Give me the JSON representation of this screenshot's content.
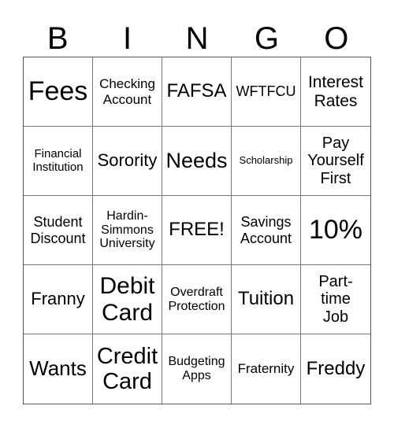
{
  "header": [
    "B",
    "I",
    "N",
    "G",
    "O"
  ],
  "cells": [
    {
      "text": "Fees",
      "size": 34
    },
    {
      "text": "Checking Account",
      "size": 17
    },
    {
      "text": "FAFSA",
      "size": 24
    },
    {
      "text": "WFTFCU",
      "size": 18
    },
    {
      "text": "Interest Rates",
      "size": 21
    },
    {
      "text": "Financial Institution",
      "size": 15
    },
    {
      "text": "Sorority",
      "size": 22
    },
    {
      "text": "Needs",
      "size": 27
    },
    {
      "text": "Scholarship",
      "size": 13
    },
    {
      "text": "Pay Yourself First",
      "size": 20
    },
    {
      "text": "Student Discount",
      "size": 18
    },
    {
      "text": "Hardin-Simmons University",
      "size": 16
    },
    {
      "text": "FREE!",
      "size": 24
    },
    {
      "text": "Savings Account",
      "size": 18
    },
    {
      "text": "10%",
      "size": 34
    },
    {
      "text": "Franny",
      "size": 22
    },
    {
      "text": "Debit Card",
      "size": 30
    },
    {
      "text": "Overdraft Protection",
      "size": 16
    },
    {
      "text": "Tuition",
      "size": 24
    },
    {
      "text": "Part-time Job",
      "size": 20
    },
    {
      "text": "Wants",
      "size": 26
    },
    {
      "text": "Credit Card",
      "size": 29
    },
    {
      "text": "Budgeting Apps",
      "size": 16
    },
    {
      "text": "Fraternity",
      "size": 17
    },
    {
      "text": "Freddy",
      "size": 24
    }
  ]
}
